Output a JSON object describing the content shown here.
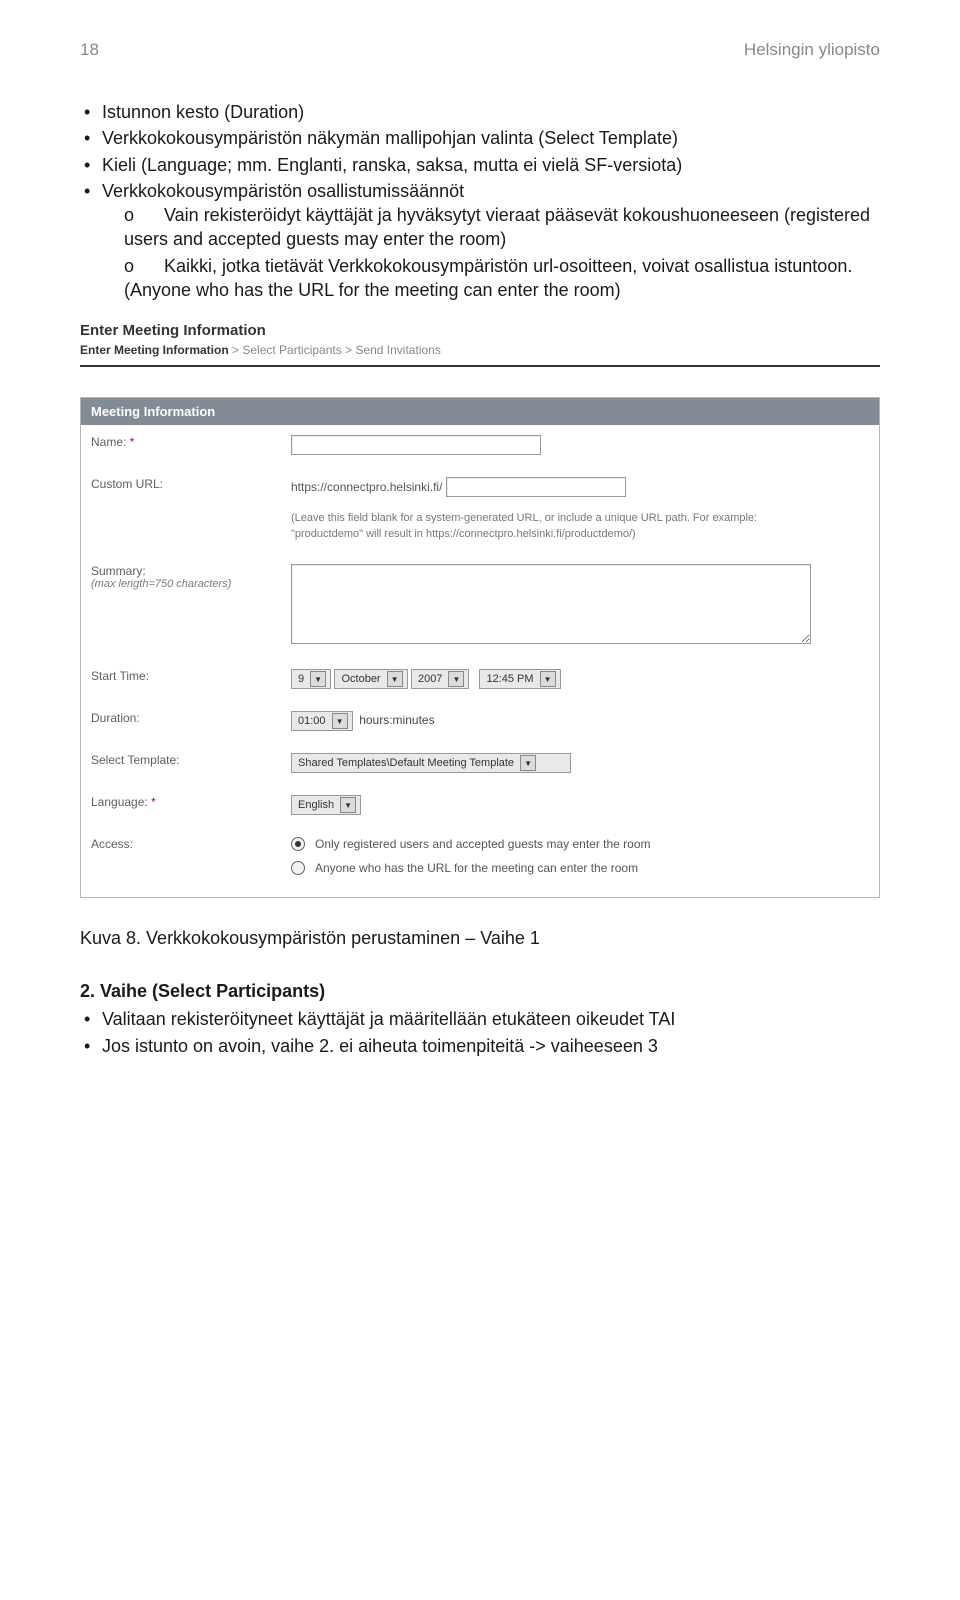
{
  "header": {
    "page_number": "18",
    "doc_title": "Helsingin yliopisto"
  },
  "bullets": {
    "b1": "Istunnon kesto (Duration)",
    "b2": "Verkkokokousympäristön näkymän mallipohjan valinta (Select Template)",
    "b3": "Kieli (Language; mm. Englanti, ranska, saksa, mutta ei vielä SF-versiota)",
    "b4": "Verkkokokousympäristön osallistumissäännöt"
  },
  "sublist": {
    "o": "o",
    "s1": "Vain rekisteröidyt käyttäjät ja hyväksytyt vieraat pääsevät kokoushuoneeseen (registered users and accepted guests may enter the room)",
    "s2": "Kaikki, jotka tietävät Verkkokokousympäristön url-osoitteen, voivat osallistua istuntoon. (Anyone who has the URL for the meeting can enter the room)"
  },
  "screenshot": {
    "title": "Enter Meeting Information",
    "crumb_active": "Enter Meeting Information",
    "crumb_sep": " > ",
    "crumb2": "Select Participants",
    "crumb3": "Send Invitations",
    "panel_header": "Meeting Information",
    "labels": {
      "name": "Name:",
      "customurl": "Custom URL:",
      "summary": "Summary:",
      "summary_sub": "(max length=750 characters)",
      "start": "Start Time:",
      "duration": "Duration:",
      "template": "Select Template:",
      "language": "Language:",
      "access": "Access:",
      "req": "*"
    },
    "values": {
      "url_prefix": "https://connectpro.helsinki.fi/",
      "hint": "(Leave this field blank for a system-generated URL, or include a unique URL path. For example: \"productdemo\" will result in https://connectpro.helsinki.fi/productdemo/)",
      "day": "9",
      "month": "October",
      "year": "2007",
      "time": "12:45 PM",
      "dur": "01:00",
      "dur_suffix": "hours:minutes",
      "template": "Shared Templates\\Default Meeting Template",
      "language": "English",
      "access1": "Only registered users and accepted guests may enter the room",
      "access2": "Anyone who has the URL for the meeting can enter the room"
    }
  },
  "caption": "Kuva 8. Verkkokokousympäristön perustaminen – Vaihe 1",
  "step2": {
    "title": "2. Vaihe (Select Participants)",
    "b1": "Valitaan rekisteröityneet käyttäjät ja määritellään etukäteen oikeudet TAI",
    "b2": "Jos istunto on avoin, vaihe 2. ei aiheuta toimenpiteitä -> vaiheeseen 3"
  }
}
